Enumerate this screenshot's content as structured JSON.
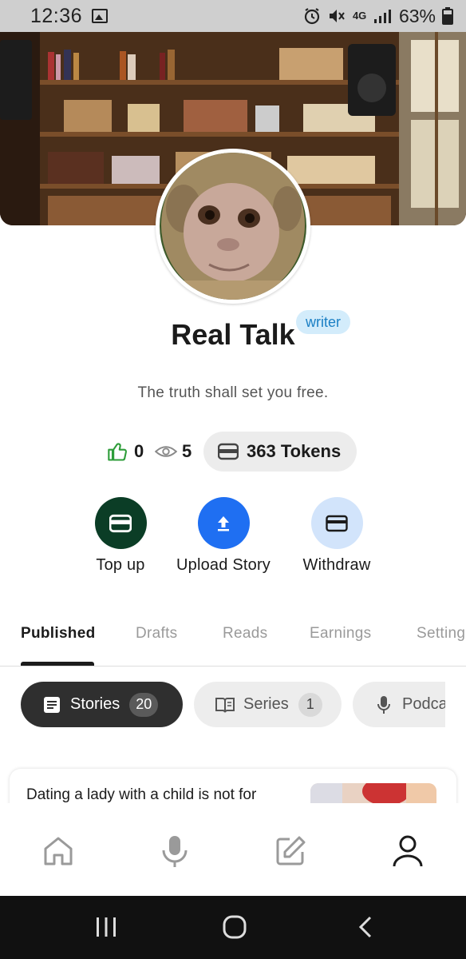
{
  "status_bar": {
    "time": "12:36",
    "battery": "63%",
    "network": "4G"
  },
  "profile": {
    "name": "Real Talk",
    "badge": "writer",
    "bio": "The truth shall set you free."
  },
  "stats": {
    "likes": "0",
    "views": "5",
    "tokens": "363 Tokens"
  },
  "actions": [
    {
      "label": "Top up",
      "icon": "wallet-icon",
      "color": "#0b3d26"
    },
    {
      "label": "Upload Story",
      "icon": "upload-icon",
      "color": "#1f6ff2"
    },
    {
      "label": "Withdraw",
      "icon": "card-icon",
      "color": "#d2e4fb"
    }
  ],
  "tabs": [
    {
      "label": "Published",
      "active": true
    },
    {
      "label": "Drafts"
    },
    {
      "label": "Reads"
    },
    {
      "label": "Earnings"
    },
    {
      "label": "Setting"
    }
  ],
  "chips": [
    {
      "label": "Stories",
      "count": "20",
      "active": true
    },
    {
      "label": "Series",
      "count": "1"
    },
    {
      "label": "Podca"
    }
  ],
  "story": {
    "title": "Dating a lady with a child is not for"
  },
  "bottom_nav": [
    {
      "name": "home-icon"
    },
    {
      "name": "microphone-icon"
    },
    {
      "name": "edit-icon"
    },
    {
      "name": "profile-icon",
      "active": true
    }
  ],
  "colors": {
    "like_green": "#2e9d3a",
    "badge_bg": "#d3ecfb",
    "badge_text": "#1a7fc4",
    "dark_chip": "#2f2f2f"
  }
}
